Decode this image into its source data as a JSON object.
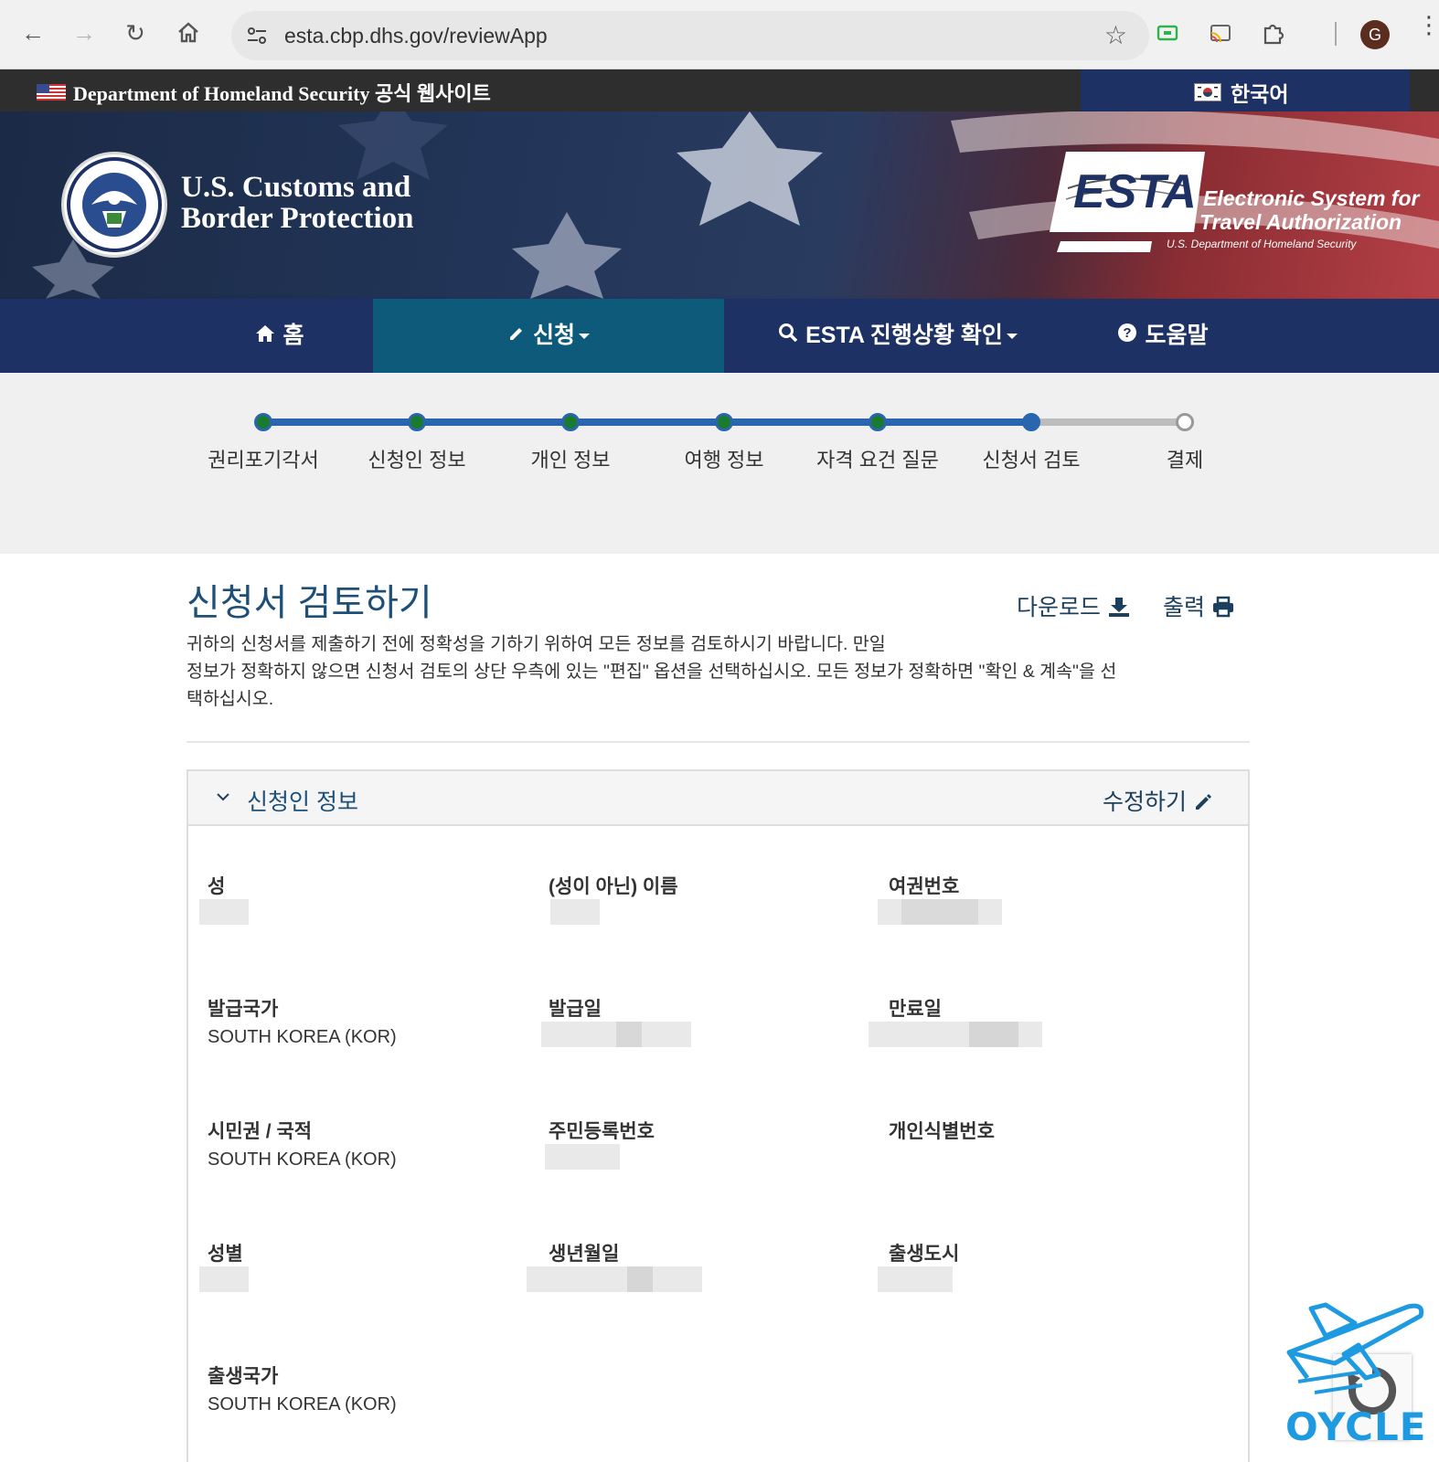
{
  "browser": {
    "url": "esta.cbp.dhs.gov/reviewApp",
    "profile_initial": "G"
  },
  "dhs_bar": {
    "text": "Department of Homeland Security 공식 웹사이트",
    "language": "한국어"
  },
  "banner": {
    "agency_line1": "U.S. Customs and",
    "agency_line2": "Border Protection",
    "esta_word": "ESTA",
    "esta_line1": "Electronic System for",
    "esta_line2": "Travel Authorization",
    "esta_sub": "U.S. Department of Homeland Security"
  },
  "nav": {
    "home": "홈",
    "apply": "신청",
    "status": "ESTA 진행상황 확인",
    "help": "도움말"
  },
  "progress": {
    "steps": [
      "권리포기각서",
      "신청인 정보",
      "개인 정보",
      "여행 정보",
      "자격 요건 질문",
      "신청서 검토",
      "결제"
    ],
    "current_step": 6
  },
  "review": {
    "title": "신청서 검토하기",
    "download": "다운로드",
    "print": "출력",
    "intro_line1": "귀하의 신청서를 제출하기 전에 정확성을 기하기 위하여 모든 정보를 검토하시기 바랍니다. 만일",
    "intro_line2": "정보가 정확하지 않으면 신청서 검토의 상단 우측에 있는 \"편집\" 옵션을 선택하십시오. 모든 정보가 정확하면 \"확인 & 계속\"을 선",
    "intro_line3": "택하십시오."
  },
  "applicant_panel": {
    "title": "신청인 정보",
    "edit": "수정하기",
    "fields": [
      {
        "label": "성",
        "value": ""
      },
      {
        "label": "(성이 아닌) 이름",
        "value": ""
      },
      {
        "label": "여권번호",
        "value": ""
      },
      {
        "label": "발급국가",
        "value": "SOUTH KOREA (KOR)"
      },
      {
        "label": "발급일",
        "value": ""
      },
      {
        "label": "만료일",
        "value": ""
      },
      {
        "label": "시민권 / 국적",
        "value": "SOUTH KOREA (KOR)"
      },
      {
        "label": "주민등록번호",
        "value": ""
      },
      {
        "label": "개인식별번호",
        "value": ""
      },
      {
        "label": "성별",
        "value": ""
      },
      {
        "label": "생년월일",
        "value": ""
      },
      {
        "label": "출생도시",
        "value": ""
      },
      {
        "label": "출생국가",
        "value": "SOUTH KOREA (KOR)"
      }
    ]
  },
  "watermark": {
    "text": "OYCLE"
  },
  "colors": {
    "nav_bg": "#1d3164",
    "nav_active": "#0e5a7a",
    "progress_done": "#1a7a2e",
    "progress_line": "#2a66b0",
    "title_blue": "#1d4f78"
  }
}
